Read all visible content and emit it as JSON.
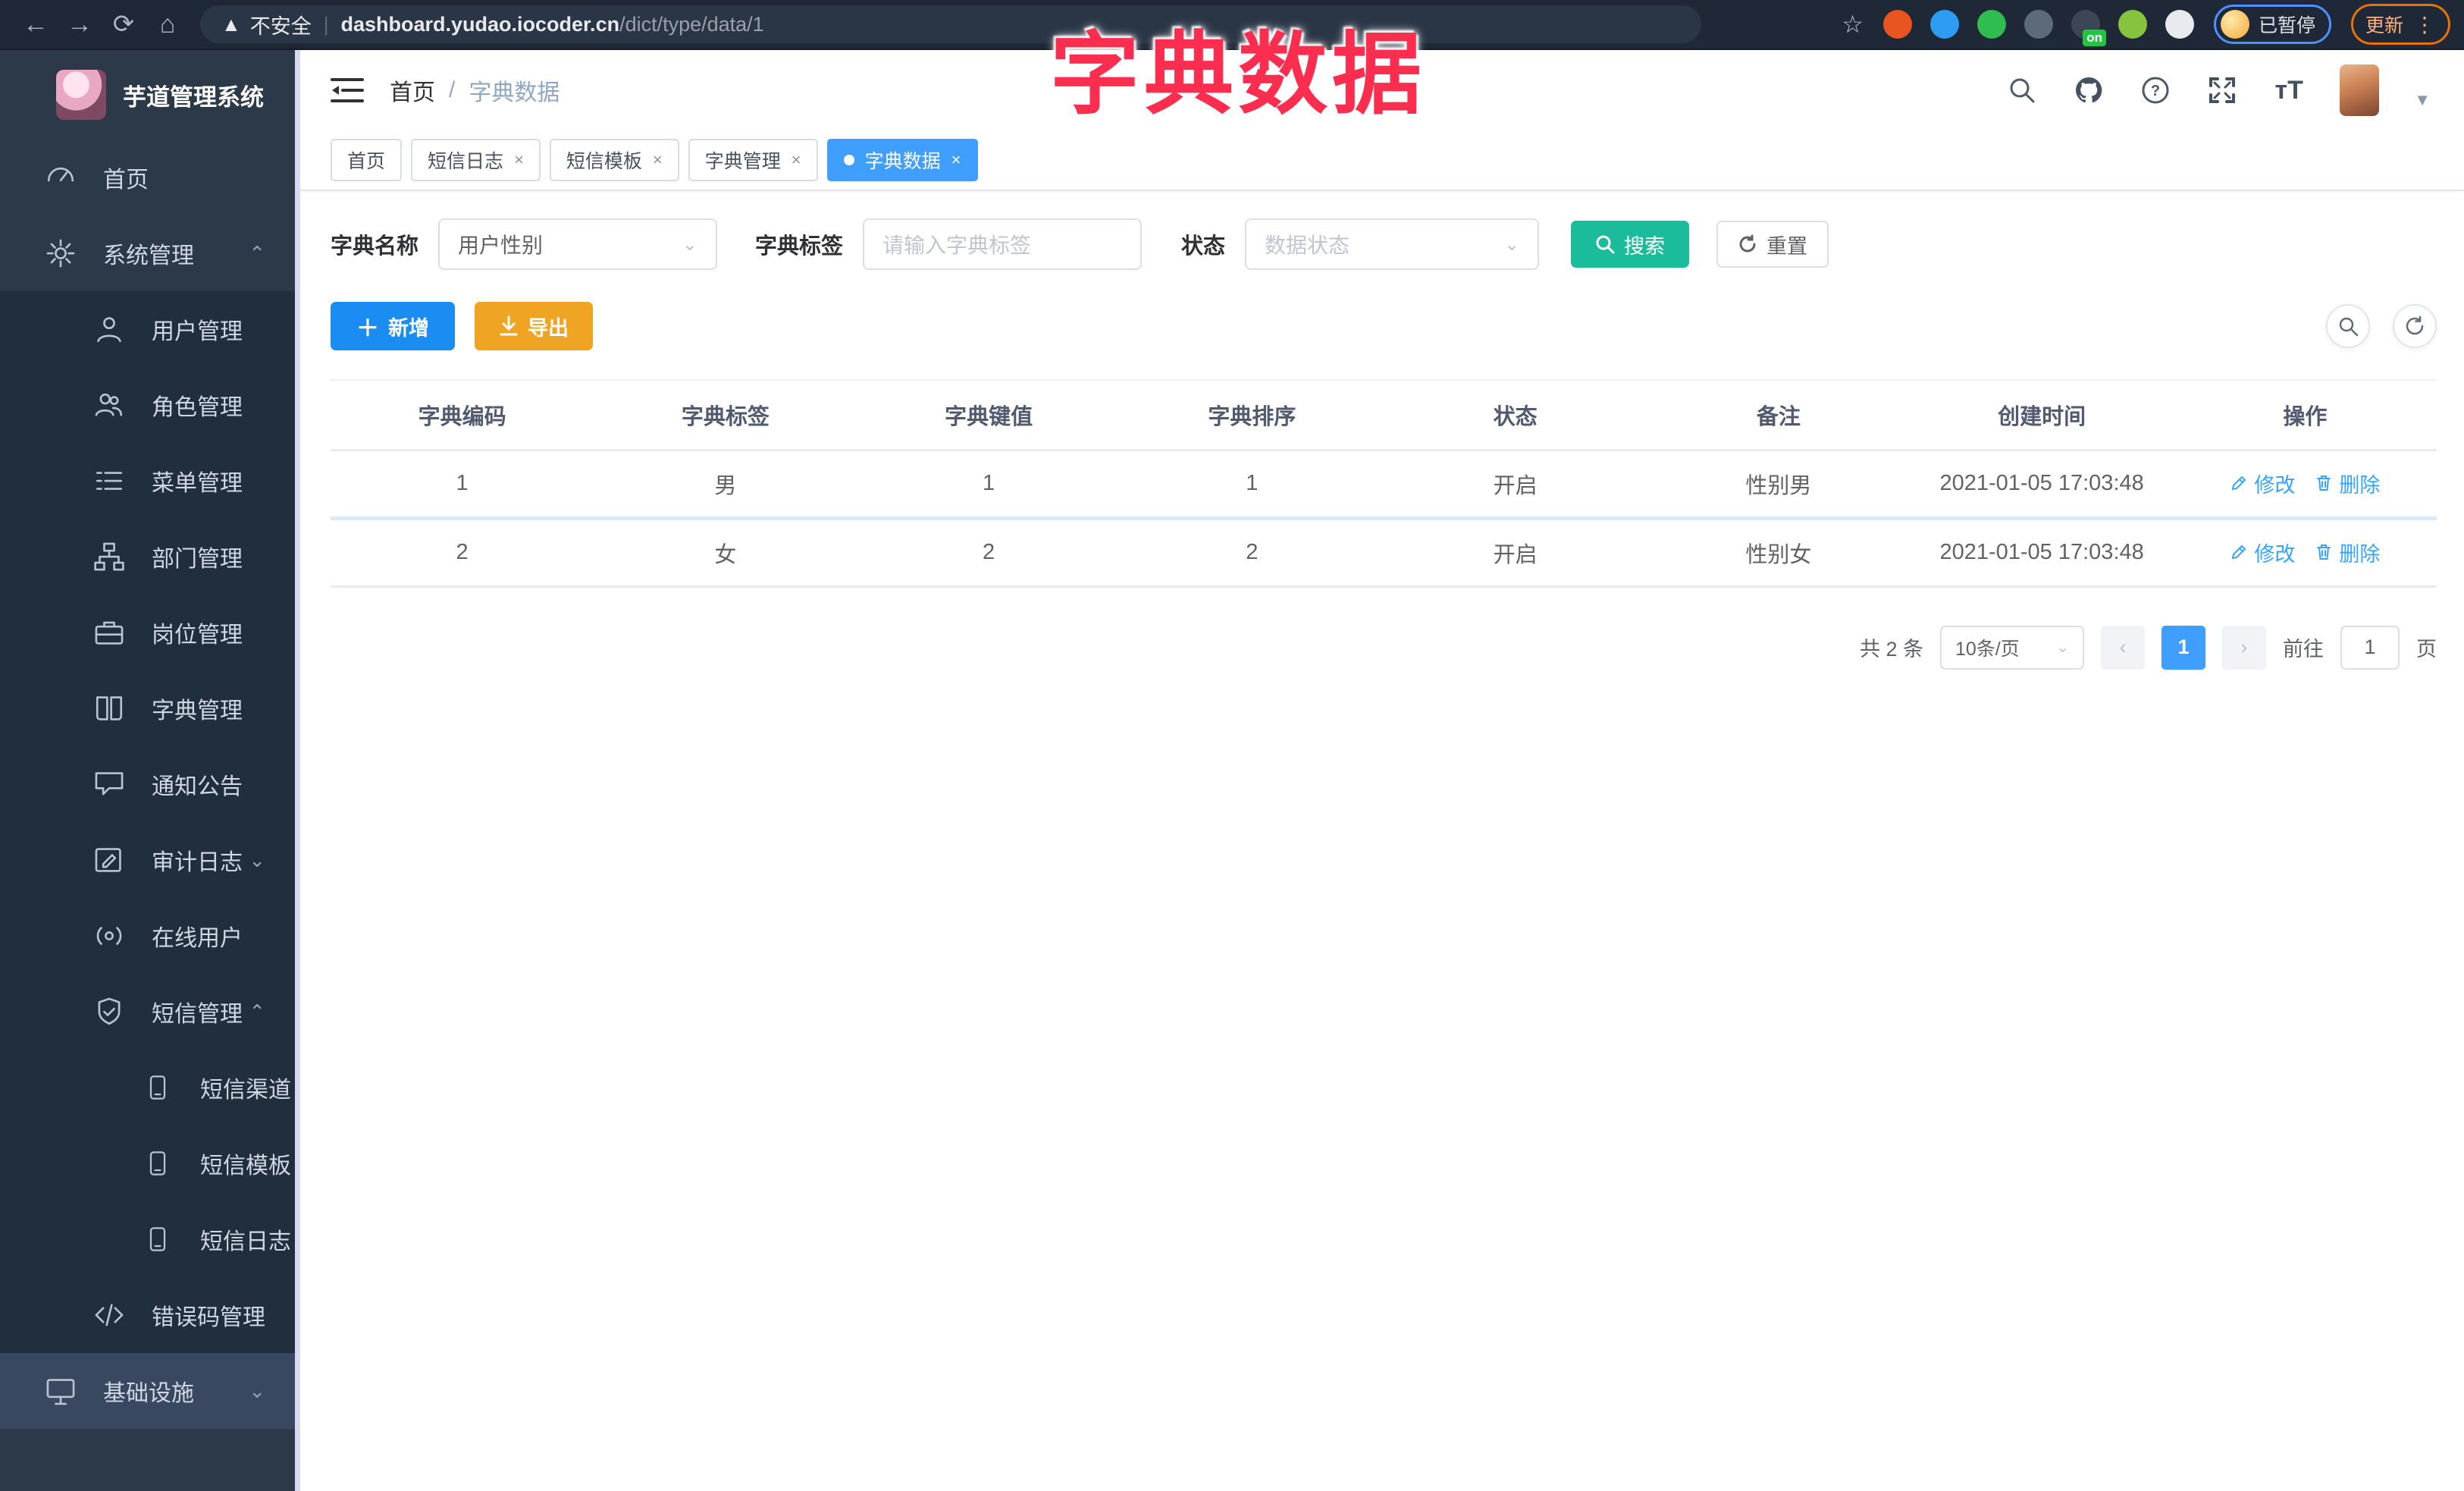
{
  "colors": {
    "accent": "#409eff",
    "search_teal": "#1abc9c",
    "export_orange": "#f0a423",
    "add_blue": "#1b8df2",
    "overlay_red": "#fb2e50",
    "operation_link": "#35a4ff"
  },
  "overlay": {
    "title": "字典数据"
  },
  "browser": {
    "security_warning": "不安全",
    "url_host": "dashboard.yudao.iocoder.cn",
    "url_path": "/dict/type/data/1",
    "profile_label": "已暂停",
    "update_label": "更新",
    "extensions": [
      {
        "name": "extension-orange-ring",
        "color": "#e95420"
      },
      {
        "name": "extension-blue-drop",
        "color": "#2f9cf4"
      },
      {
        "name": "extension-green-check",
        "color": "#2ebd4e"
      },
      {
        "name": "extension-gray-tool",
        "color": "#5d6a7a"
      },
      {
        "name": "extension-dark-switch",
        "color": "#3c4654",
        "badge": "on"
      },
      {
        "name": "extension-green-sprout",
        "color": "#86c440"
      },
      {
        "name": "extension-puzzle",
        "color": "#e8eaed"
      }
    ]
  },
  "sidebar": {
    "app_title": "芋道管理系统",
    "items": [
      {
        "name": "home",
        "label": "首页",
        "icon": "dashboard",
        "level": 1
      },
      {
        "name": "system-management",
        "label": "系统管理",
        "icon": "gear",
        "level": 1,
        "chevron": "up"
      },
      {
        "name": "user-management",
        "label": "用户管理",
        "icon": "user",
        "level": 2
      },
      {
        "name": "role-management",
        "label": "角色管理",
        "icon": "users",
        "level": 2
      },
      {
        "name": "menu-management",
        "label": "菜单管理",
        "icon": "list",
        "level": 2
      },
      {
        "name": "department-management",
        "label": "部门管理",
        "icon": "tree",
        "level": 2
      },
      {
        "name": "post-management",
        "label": "岗位管理",
        "icon": "briefcase",
        "level": 2
      },
      {
        "name": "dict-management",
        "label": "字典管理",
        "icon": "book",
        "level": 2
      },
      {
        "name": "notice-announcement",
        "label": "通知公告",
        "icon": "chat",
        "level": 2
      },
      {
        "name": "audit-log",
        "label": "审计日志",
        "icon": "editlog",
        "level": 2,
        "chevron": "down"
      },
      {
        "name": "online-users",
        "label": "在线用户",
        "icon": "online",
        "level": 2
      },
      {
        "name": "sms-management",
        "label": "短信管理",
        "icon": "shield",
        "level": 2,
        "chevron": "up"
      },
      {
        "name": "sms-channel",
        "label": "短信渠道",
        "icon": "phone",
        "level": 3
      },
      {
        "name": "sms-template",
        "label": "短信模板",
        "icon": "phone",
        "level": 3
      },
      {
        "name": "sms-log",
        "label": "短信日志",
        "icon": "phone",
        "level": 3
      },
      {
        "name": "error-code-management",
        "label": "错误码管理",
        "icon": "code",
        "level": 2
      },
      {
        "name": "infrastructure",
        "label": "基础设施",
        "icon": "monitor",
        "level": 1,
        "chevron": "down",
        "infra": true
      }
    ]
  },
  "header": {
    "breadcrumb_home": "首页",
    "breadcrumb_sep": "/",
    "breadcrumb_current": "字典数据"
  },
  "tabs": [
    {
      "name": "home",
      "label": "首页",
      "closable": false,
      "active": false
    },
    {
      "name": "sms-log",
      "label": "短信日志",
      "closable": true,
      "active": false
    },
    {
      "name": "sms-template",
      "label": "短信模板",
      "closable": true,
      "active": false
    },
    {
      "name": "dict-management",
      "label": "字典管理",
      "closable": true,
      "active": false
    },
    {
      "name": "dict-data",
      "label": "字典数据",
      "closable": true,
      "active": true
    }
  ],
  "filters": {
    "dict_name_label": "字典名称",
    "dict_name_value": "用户性别",
    "dict_label_label": "字典标签",
    "dict_label_placeholder": "请输入字典标签",
    "status_label": "状态",
    "status_placeholder": "数据状态",
    "search_label": "搜索",
    "reset_label": "重置"
  },
  "toolbar": {
    "add_label": "新增",
    "export_label": "导出"
  },
  "table": {
    "headers": [
      "字典编码",
      "字典标签",
      "字典键值",
      "字典排序",
      "状态",
      "备注",
      "创建时间",
      "操作"
    ],
    "rows": [
      [
        "1",
        "男",
        "1",
        "1",
        "开启",
        "性别男",
        "2021-01-05 17:03:48"
      ],
      [
        "2",
        "女",
        "2",
        "2",
        "开启",
        "性别女",
        "2021-01-05 17:03:48"
      ]
    ],
    "edit_label": "修改",
    "delete_label": "删除"
  },
  "pagination": {
    "total_text": "共 2 条",
    "page_size": "10条/页",
    "current_page": "1",
    "prev_glyph": "‹",
    "next_glyph": "›",
    "goto_label": "前往",
    "goto_value": "1",
    "page_suffix": "页"
  }
}
